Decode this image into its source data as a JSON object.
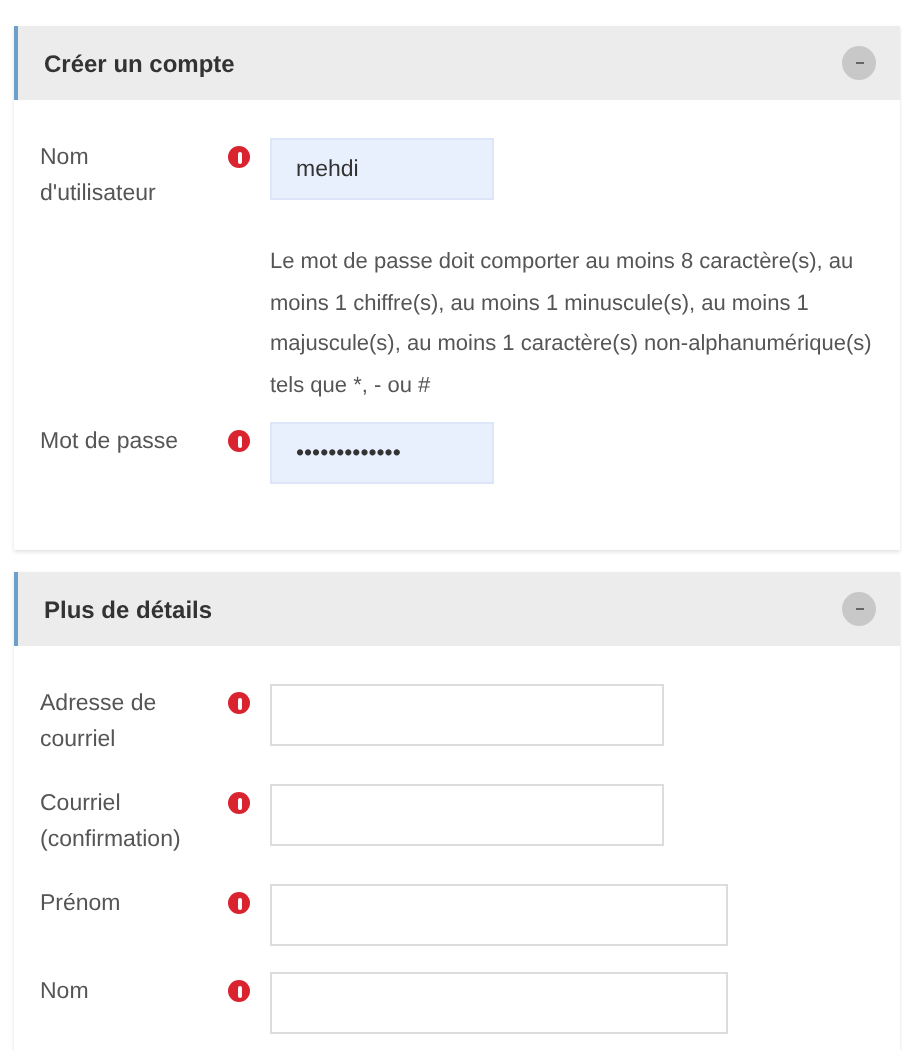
{
  "sections": [
    {
      "title": "Créer un compte",
      "expanded": true,
      "items": [
        {
          "kind": "short",
          "label": "Nom d'utilisateur",
          "required": true,
          "value": "mehdi"
        },
        {
          "kind": "help",
          "text": "Le mot de passe doit comporter au moins 8 caractère(s), au moins 1 chiffre(s), au moins 1 minuscule(s), au moins 1 majuscule(s), au moins 1 caractère(s) non-alphanumérique(s) tels que *, - ou #"
        },
        {
          "kind": "short",
          "label": "Mot de passe",
          "required": true,
          "value": "•••••••••••••"
        }
      ]
    },
    {
      "title": "Plus de détails",
      "expanded": true,
      "items": [
        {
          "kind": "medium",
          "label": "Adresse de courriel",
          "required": true,
          "value": ""
        },
        {
          "kind": "medium",
          "label": "Courriel (confirmation)",
          "required": true,
          "value": ""
        },
        {
          "kind": "long",
          "label": "Prénom",
          "required": true,
          "value": ""
        },
        {
          "kind": "long",
          "label": "Nom",
          "required": true,
          "value": ""
        }
      ]
    }
  ]
}
